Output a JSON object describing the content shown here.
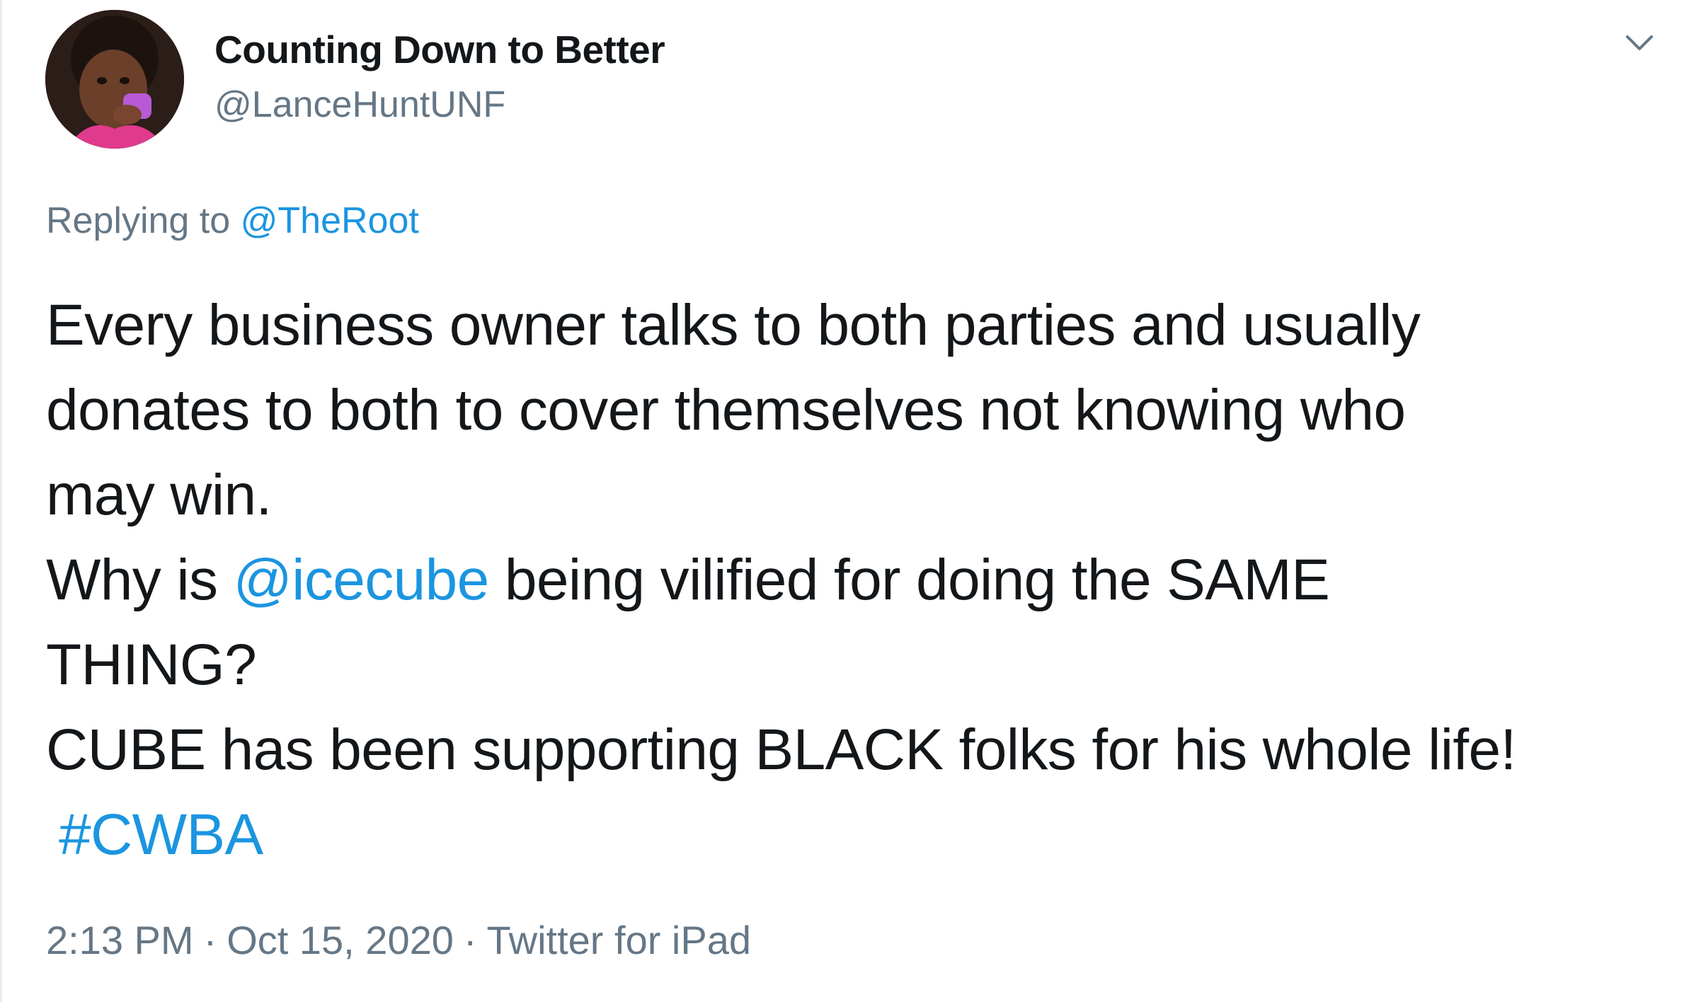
{
  "author": {
    "display_name": "Counting Down to Better",
    "handle": "@LanceHuntUNF"
  },
  "reply": {
    "prefix": "Replying to ",
    "to": "@TheRoot"
  },
  "body": {
    "line1": "Every business owner talks to both parties and usually",
    "line2": "donates to both to cover themselves not knowing who",
    "line3": "may win.",
    "line4_pre": "Why is ",
    "line4_mention": "@icecube",
    "line4_post": " being vilified for doing the SAME",
    "line5": "THING?",
    "line6": "CUBE has been supporting BLACK folks for his whole life!",
    "hashtag": "#CWBA"
  },
  "meta": {
    "time": "2:13 PM",
    "separator": "·",
    "date": "Oct 15, 2020",
    "source": "Twitter for iPad"
  },
  "icons": {
    "caret": "chevron-down-icon",
    "avatar": "avatar-photo"
  },
  "colors": {
    "link": "#1b95e0",
    "secondary_text": "#657786",
    "primary_text": "#14171a"
  }
}
